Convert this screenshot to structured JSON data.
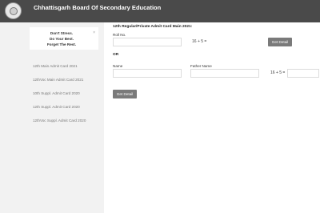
{
  "header": {
    "title": "Chhattisgarh Board Of Secondary Education"
  },
  "sidebar": {
    "alert": {
      "line1": "Don't Stress.",
      "line2": "Do Your Best.",
      "line3": "Forget The Rest.",
      "close": "×"
    },
    "items": [
      {
        "label": "12th Main Admit Card 2021"
      },
      {
        "label": "12thVoc Main Admit Card 2021"
      },
      {
        "label": "10th Suppl. Admit Card 2020"
      },
      {
        "label": "12th Suppl. Admit Card 2020"
      },
      {
        "label": "12thVoc Suppl. Admit Card 2020"
      }
    ]
  },
  "main": {
    "section_title": "12th Regular/Private Admit Card Main 2021:",
    "roll_label": "Roll No.",
    "roll_value": "",
    "captcha1": "16 + 5 =",
    "captcha1_value": "",
    "get_detail_1": "Get Detail",
    "or_label": "OR",
    "name_label": "Name",
    "name_value": "",
    "father_label": "Father Name",
    "father_value": "",
    "captcha2": "16 + 5 =",
    "captcha2_value": "",
    "get_detail_2": "Get Detail"
  }
}
